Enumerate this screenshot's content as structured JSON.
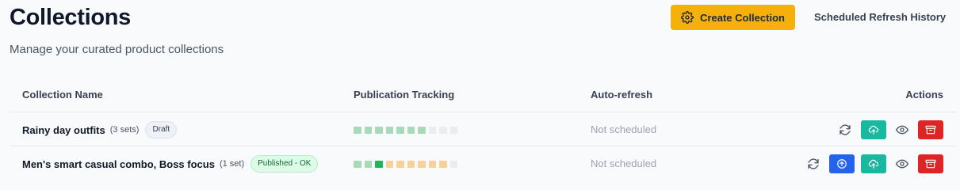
{
  "header": {
    "title": "Collections",
    "subtitle": "Manage your curated product collections",
    "create_label": "Create Collection",
    "history_label": "Scheduled Refresh History"
  },
  "table": {
    "columns": {
      "name": "Collection Name",
      "publication": "Publication Tracking",
      "auto_refresh": "Auto-refresh",
      "actions": "Actions"
    },
    "rows": [
      {
        "name": "Rainy day outfits",
        "sets": "(3 sets)",
        "status": "Draft",
        "tracking": [
          "light-green",
          "light-green",
          "light-green",
          "light-green",
          "light-green",
          "light-green",
          "light-green",
          "empty",
          "empty",
          "empty"
        ],
        "auto_refresh": "Not scheduled",
        "actions": [
          "refresh-icon",
          "publish-button",
          "preview-icon",
          "archive-button"
        ]
      },
      {
        "name": "Men's smart casual combo, Boss focus",
        "sets": "(1 set)",
        "status": "Published - OK",
        "tracking": [
          "light-green",
          "light-green",
          "dark-green",
          "orange",
          "orange",
          "orange",
          "orange",
          "orange",
          "orange",
          "empty"
        ],
        "auto_refresh": "Not scheduled",
        "actions": [
          "refresh-icon",
          "upload-button",
          "publish-button",
          "preview-icon",
          "archive-button"
        ]
      }
    ]
  },
  "colors": {
    "accent": "#f5b00a",
    "teal": "#19b9a0",
    "blue": "#2563eb",
    "red": "#dc2626",
    "track_light_green": "#a7dbb8",
    "track_dark_green": "#22b45a",
    "track_orange": "#f7d19a",
    "track_empty": "#e9ecf0"
  }
}
